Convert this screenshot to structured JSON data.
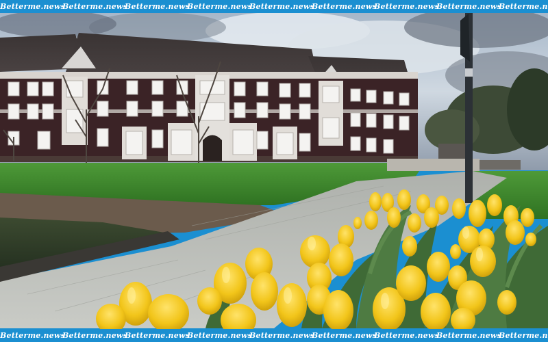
{
  "watermark": {
    "text": "Betterme.news",
    "color": "#ffffff",
    "banner_color": "#1b8fd1"
  },
  "scene": {
    "subject": "brick-building-lawn-yellow-tulips",
    "tulip_color": "#f2c51a",
    "lawn_color": "#3f8a2c",
    "brick_color": "#3b2326"
  }
}
